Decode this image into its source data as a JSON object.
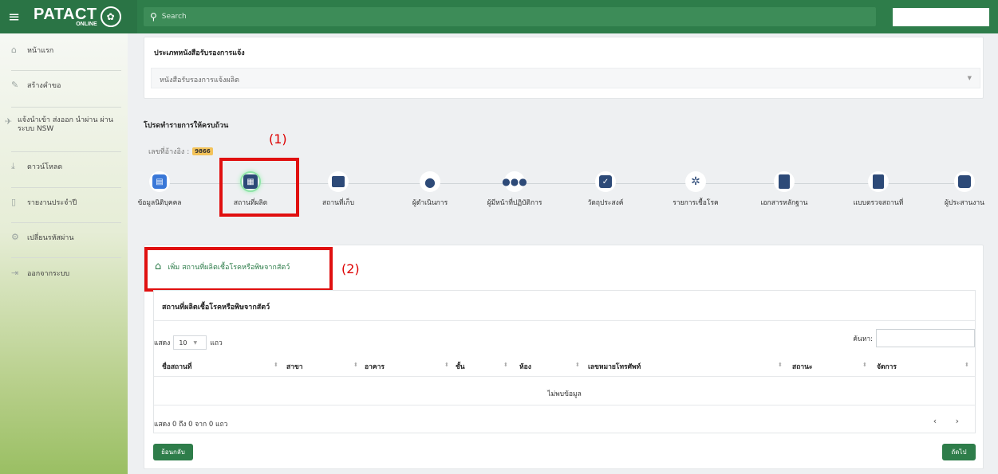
{
  "header": {
    "logo_text": "PATACT",
    "logo_sub": "ONLINE",
    "search_placeholder": "Search"
  },
  "sidebar": {
    "items": [
      {
        "label": "หน้าแรก",
        "icon": "home-icon"
      },
      {
        "label": "สร้างคำขอ",
        "icon": "pencil-icon"
      },
      {
        "label": "แจ้งนำเข้า ส่งออก นำผ่าน ผ่านระบบ NSW",
        "icon": "plane-icon"
      },
      {
        "label": "ดาวน์โหลด",
        "icon": "download-icon"
      },
      {
        "label": "รายงานประจำปี",
        "icon": "document-icon"
      },
      {
        "label": "เปลี่ยนรหัสผ่าน",
        "icon": "gears-icon"
      },
      {
        "label": "ออกจากระบบ",
        "icon": "logout-icon"
      }
    ]
  },
  "certificate": {
    "label": "ประเภทหนังสือรับรองการแจ้ง",
    "value": "หนังสือรับรองการแจ้งผลิต"
  },
  "instructions": "โปรดทำรายการให้ครบถ้วน",
  "reference": {
    "label": "เลขที่อ้างอิง :",
    "number": "9866"
  },
  "annotations": {
    "one": "(1)",
    "two": "(2)"
  },
  "steps": [
    {
      "label": "ข้อมูลนิติบุคคล",
      "icon": "id-card-icon"
    },
    {
      "label": "สถานที่ผลิต",
      "icon": "building-icon"
    },
    {
      "label": "สถานที่เก็บ",
      "icon": "archive-icon"
    },
    {
      "label": "ผู้ดำเนินการ",
      "icon": "user-icon"
    },
    {
      "label": "ผู้มีหน้าที่ปฏิบัติการ",
      "icon": "users-icon"
    },
    {
      "label": "วัตถุประสงค์",
      "icon": "check-square-icon"
    },
    {
      "label": "รายการเชื้อโรค",
      "icon": "virus-icon"
    },
    {
      "label": "เอกสารหลักฐาน",
      "icon": "file-icon"
    },
    {
      "label": "แบบตรวจสถานที่",
      "icon": "clipboard-icon"
    },
    {
      "label": "ผู้ประสานงาน",
      "icon": "phone-book-icon"
    }
  ],
  "add_link": "เพิ่ม สถานที่ผลิตเชื้อโรคหรือพิษจากสัตว์",
  "table": {
    "title": "สถานที่ผลิตเชื้อโรคหรือพิษจากสัตว์",
    "show_label": "แสดง",
    "show_value": "10",
    "rows_label": "แถว",
    "search_label": "ค้นหา:",
    "columns": [
      "ชื่อสถานที่",
      "สาขา",
      "อาคาร",
      "ชั้น",
      "ห้อง",
      "เลขหมายโทรศัพท์",
      "สถานะ",
      "จัดการ"
    ],
    "empty": "ไม่พบข้อมูล",
    "info": "แสดง 0 ถึง 0 จาก 0 แถว",
    "pager": "‹ ›"
  },
  "buttons": {
    "back": "ย้อนกลับ",
    "next": "ถัดไป"
  },
  "colors": {
    "brand_green": "#2e7d4a",
    "step_navy": "#2d4a78",
    "annotation_red": "#e01010"
  }
}
